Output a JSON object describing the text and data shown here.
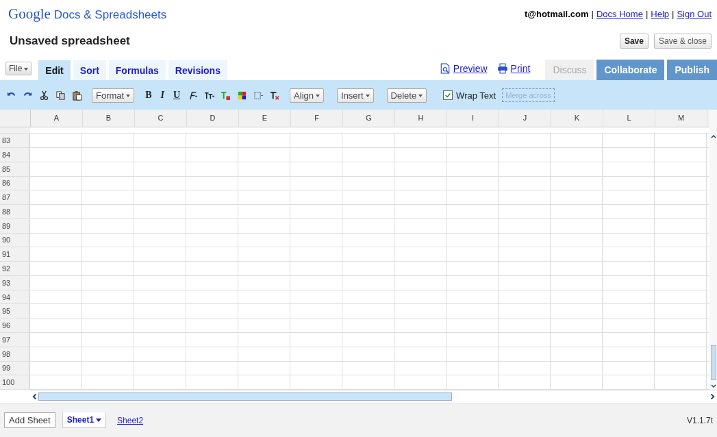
{
  "header": {
    "logo": "Google",
    "product": "Docs & Spreadsheets",
    "account": "t@hotmail.com",
    "separator": "|",
    "links": [
      "Docs Home",
      "Help",
      "Sign Out"
    ]
  },
  "document": {
    "title": "Unsaved spreadsheet",
    "buttons": [
      {
        "label": "Save",
        "bold": true
      },
      {
        "label": "Save & close",
        "bold": false
      }
    ]
  },
  "file_menu": "File",
  "tabs": [
    {
      "label": "Edit",
      "selected": true
    },
    {
      "label": "Sort",
      "selected": false
    },
    {
      "label": "Formulas",
      "selected": false
    },
    {
      "label": "Revisions",
      "selected": false
    }
  ],
  "actions": {
    "links": [
      "Preview",
      "Print"
    ],
    "buttons": [
      {
        "label": "Discuss",
        "disabled": true
      },
      {
        "label": "Collaborate",
        "disabled": false
      },
      {
        "label": "Publish",
        "disabled": false
      }
    ]
  },
  "toolbar": {
    "format_menu": "Format",
    "text_styles": [
      "B",
      "I",
      "U"
    ],
    "menus": [
      "Align",
      "Insert",
      "Delete"
    ],
    "wrap_text": {
      "label": "Wrap Text",
      "checked": true
    },
    "merge_across": {
      "label": "Merge across",
      "disabled": true
    }
  },
  "grid": {
    "columns": [
      "A",
      "B",
      "C",
      "D",
      "E",
      "F",
      "G",
      "H",
      "I",
      "J",
      "K",
      "L",
      "M"
    ],
    "rows": [
      "83",
      "84",
      "85",
      "86",
      "87",
      "88",
      "89",
      "90",
      "91",
      "92",
      "93",
      "94",
      "95",
      "96",
      "97",
      "98",
      "99",
      "100"
    ]
  },
  "footer": {
    "add_sheet": "Add Sheet",
    "sheets": [
      {
        "label": "Sheet1",
        "selected": true
      },
      {
        "label": "Sheet2",
        "selected": false
      }
    ],
    "version": "V1.1.7t"
  }
}
